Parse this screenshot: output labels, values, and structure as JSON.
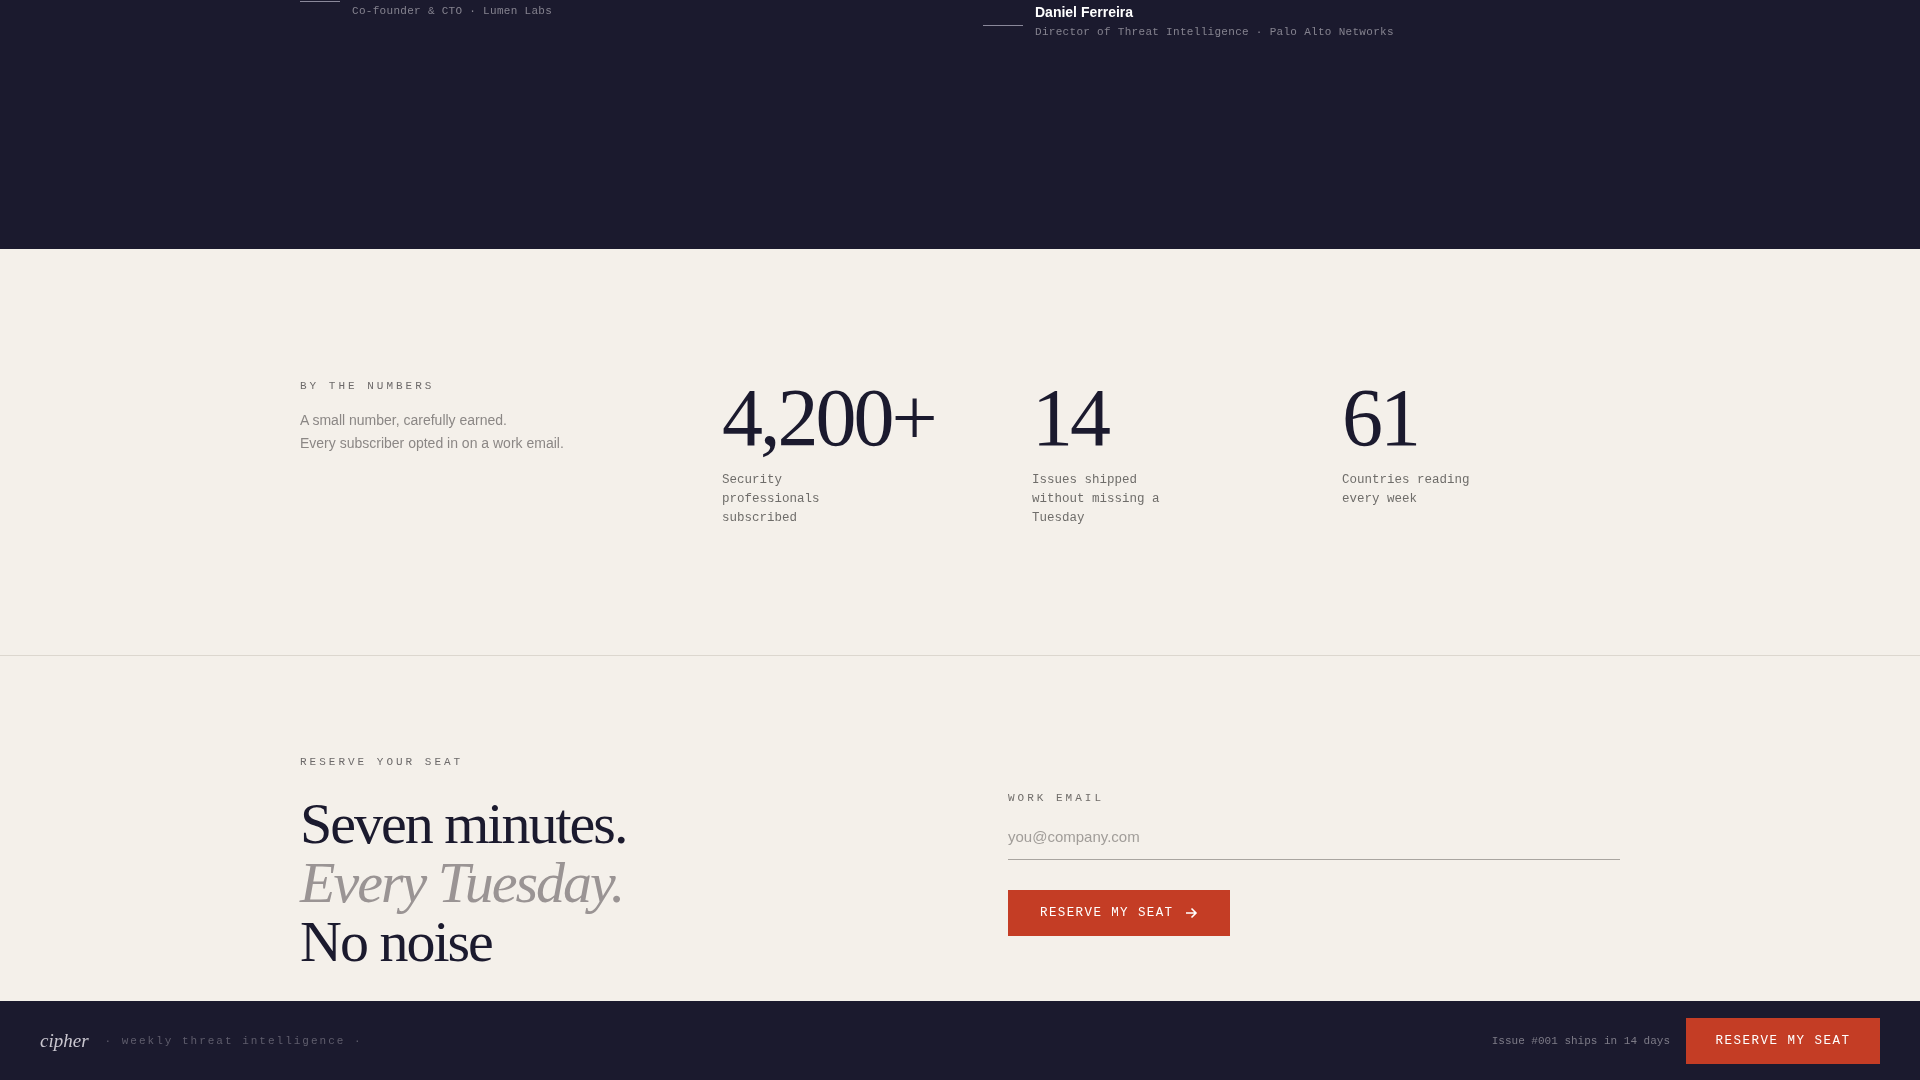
{
  "testimonials": [
    {
      "role": "Co-founder & CTO · Lumen Labs"
    },
    {
      "name": "Daniel Ferreira",
      "role": "Director of Threat Intelligence · Palo Alto Networks"
    }
  ],
  "numbers": {
    "eyebrow": "BY THE NUMBERS",
    "lines": [
      "A small number, carefully earned.",
      "Every subscriber opted in on a work email."
    ],
    "stats": [
      {
        "value": "4,200+",
        "caption": "Security professionals subscribed"
      },
      {
        "value": "14",
        "caption": "Issues shipped without missing a Tuesday"
      },
      {
        "value": "61",
        "caption": "Countries reading every week"
      }
    ]
  },
  "signup": {
    "eyebrow": "RESERVE YOUR SEAT",
    "heading": [
      {
        "text": "Seven minutes.",
        "kind": "plain"
      },
      {
        "text": "Every Tuesday.",
        "kind": "muted"
      },
      {
        "text": "No noise",
        "kind": "plain"
      }
    ],
    "field_label": "WORK EMAIL",
    "placeholder": "you@company.com",
    "button": "RESERVE MY SEAT"
  },
  "footer": {
    "logo": "cipher",
    "tagline": "· weekly threat intelligence ·",
    "note": "Issue #001 ships in 14 days",
    "button": "RESERVE MY SEAT"
  }
}
